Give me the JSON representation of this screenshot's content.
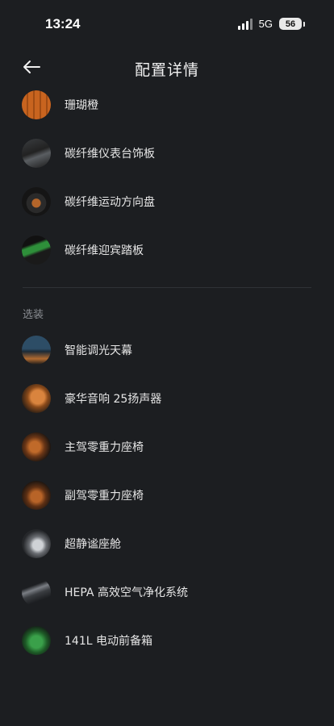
{
  "status": {
    "time": "13:24",
    "network": "5G",
    "battery": "56"
  },
  "header": {
    "title": "配置详情"
  },
  "standard_items": [
    {
      "label": "珊瑚橙",
      "icon": "coral-orange-swatch-icon"
    },
    {
      "label": "碳纤维仪表台饰板",
      "icon": "carbon-dashboard-trim-icon"
    },
    {
      "label": "碳纤维运动方向盘",
      "icon": "carbon-steering-wheel-icon"
    },
    {
      "label": "碳纤维迎宾踏板",
      "icon": "carbon-sill-plate-icon"
    }
  ],
  "optional_section": {
    "label": "选装"
  },
  "optional_items": [
    {
      "label": "智能调光天幕",
      "icon": "smart-dimming-roof-icon"
    },
    {
      "label": "豪华音响 25扬声器",
      "icon": "premium-speaker-icon"
    },
    {
      "label": "主驾零重力座椅",
      "icon": "driver-zero-gravity-seat-icon"
    },
    {
      "label": "副驾零重力座椅",
      "icon": "passenger-zero-gravity-seat-icon"
    },
    {
      "label": "超静谧座舱",
      "icon": "quiet-cabin-icon"
    },
    {
      "label": "HEPA 高效空气净化系统",
      "icon": "hepa-air-purifier-icon"
    },
    {
      "label": "141L 电动前备箱",
      "icon": "electric-frunk-icon"
    }
  ]
}
